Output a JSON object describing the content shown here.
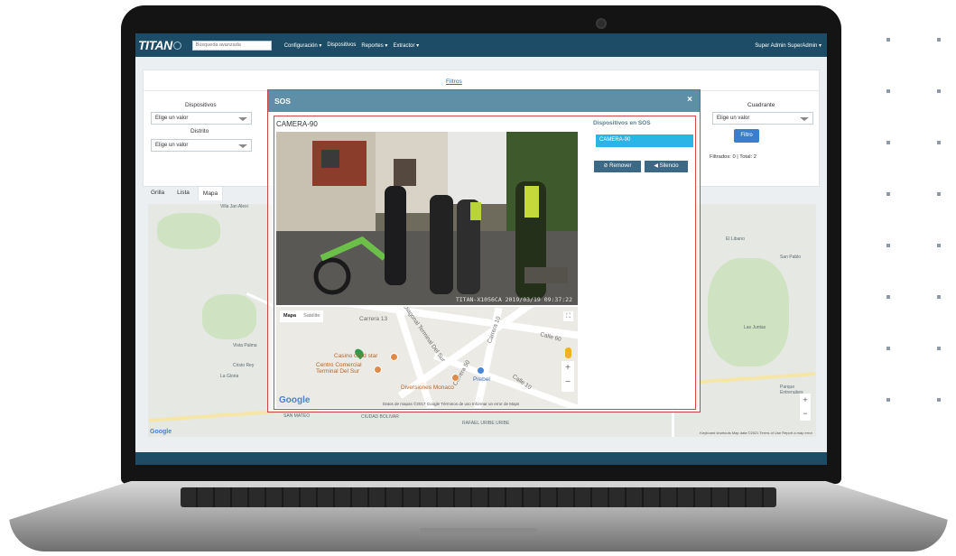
{
  "navbar": {
    "brand": "TITAN",
    "search_placeholder": "Búsqueda avanzada",
    "menu": [
      "Configuración ▾",
      "Dispositivos",
      "Reportes ▾",
      "Extractor ▾"
    ],
    "user": "Super Admin SuperAdmin ▾"
  },
  "filters": {
    "link": "Filtros",
    "dispositivos_label": "Dispositivos",
    "distrito_label": "Distrito",
    "cuadrante_label": "Cuadrante",
    "select_placeholder": "Elige un valor",
    "filter_button": "Filtro",
    "count_text": "Filtrados: 0 | Total: 2"
  },
  "view_tabs": [
    "Grilla",
    "Lista",
    "Mapa"
  ],
  "background_map": {
    "labels": [
      "Villa Jan Alexi",
      "El Libano",
      "San Pablo",
      "Las Juntas",
      "Vista Palma",
      "Cristo Rey",
      "La Gloria",
      "CIUDAD BOLIVAR",
      "RAFAEL URIBE URIBE",
      "SAN MATEO",
      "Parque Entrenubes"
    ],
    "footer": "Keyboard shortcuts   Map data ©2021   Terms of Use   Report a map error"
  },
  "modal": {
    "title": "SOS",
    "close": "×",
    "camera_title": "CAMERA-90",
    "video_overlay": "TITAN-X1056CA  2019/03/19 09:37:22",
    "devices_title": "Dispositivos en SOS",
    "device_item": "CAMERA-90",
    "remove_button": "⊘ Remover",
    "silence_button": "◀ Silencio",
    "map_toggle": [
      "Mapa",
      "Satélite"
    ],
    "map_labels": [
      "Carrera 13",
      "Carrera 10",
      "Calle 10",
      "Calle 60",
      "Diagonal Terminal Del Sur",
      "Carrera 50"
    ],
    "map_pois": [
      "Casino Gold star",
      "Centro Comercial Terminal Del Sur",
      "Diversiones Monaco",
      "Prebel"
    ],
    "map_footer": "Datos de mapas ©2017 Google   Términos de uso   Informar un error de Maps"
  }
}
